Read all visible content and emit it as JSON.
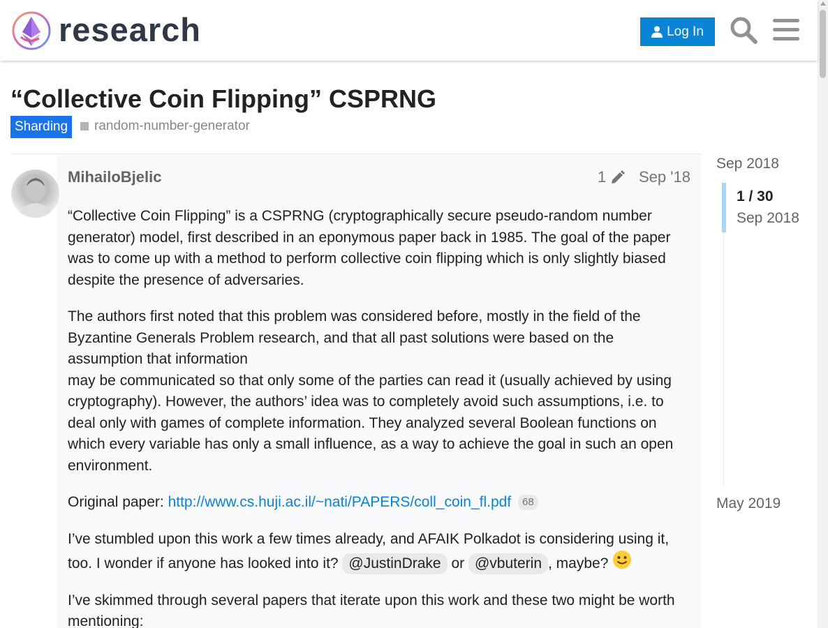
{
  "header": {
    "site_name": "research",
    "login_label": "Log In",
    "brand_color": "#0a84d6"
  },
  "topic": {
    "title": "“Collective Coin Flipping” CSPRNG",
    "category": "Sharding",
    "category_color": "#1a73e8",
    "tags": [
      "random-number-generator"
    ]
  },
  "post": {
    "username": "MihailoBjelic",
    "edit_count": "1",
    "date": "Sep '18",
    "paragraphs": {
      "p1": "“Collective Coin Flipping” is a CSPRNG (cryptographically secure pseudo-random number generator) model, first described in an eponymous paper back in 1985. The goal of the paper was to come up with a method to perform collective coin flipping which is only slightly biased despite the presence of adversaries.",
      "p2a": "The authors first noted that this problem was considered before, mostly in the field of the Byzantine Generals Problem research, and that all past solutions were based on the assumption that information",
      "p2b": "may be communicated so that only some of the parties can read it (usually achieved by using cryptography). However, the authors’ idea was to completely avoid such assumptions, i.e. to deal only with games of complete information. They analyzed several Boolean functions on which every variable has only a small influence, as a way to achieve the goal in such an open environment.",
      "p3_prefix": "Original paper: ",
      "p3_link": "http://www.cs.huji.ac.il/~nati/PAPERS/coll_coin_fl.pdf",
      "p3_clicks": "68",
      "p4_text": "I’ve stumbled upon this work a few times already, and AFAIK Polkadot is considering using it, too. I wonder if anyone has looked into it? ",
      "p4_mention1": "@JustinDrake",
      "p4_or": " or ",
      "p4_mention2": "@vbuterin",
      "p4_suffix": ", maybe? ",
      "p5": "I’ve skimmed through several papers that iterate upon this work and these two might be worth mentioning:"
    }
  },
  "timeline": {
    "start_date": "Sep 2018",
    "position": "1 / 30",
    "current_date": "Sep 2018",
    "end_date": "May 2019"
  }
}
